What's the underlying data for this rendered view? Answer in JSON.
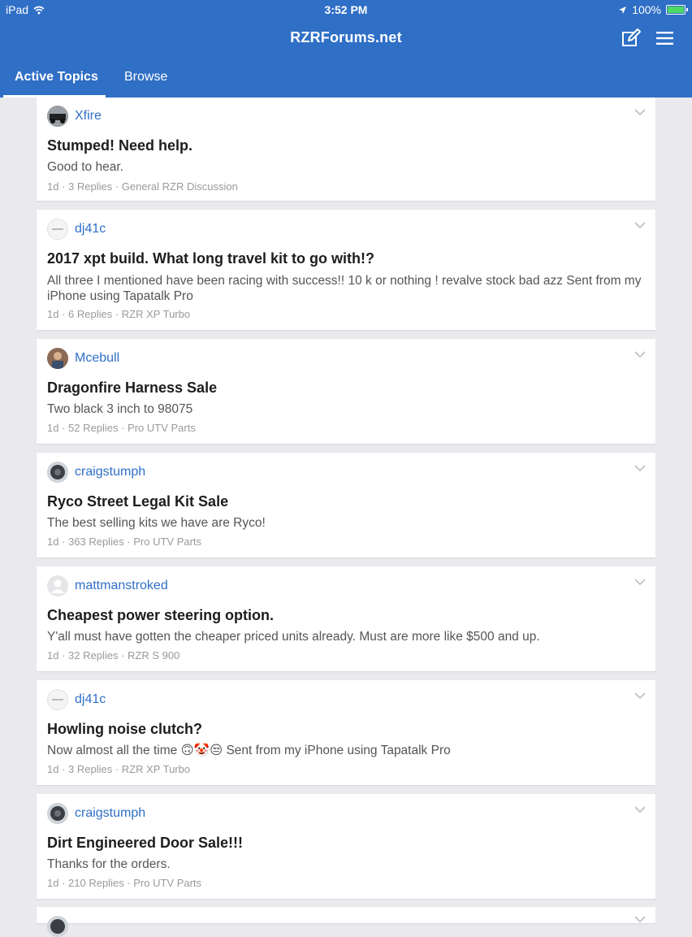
{
  "status_bar": {
    "device": "iPad",
    "time": "3:52 PM",
    "battery": "100%"
  },
  "header": {
    "title": "RZRForums.net"
  },
  "tabs": [
    {
      "label": "Active Topics"
    },
    {
      "label": "Browse"
    }
  ],
  "topics": [
    {
      "author": "Xfire",
      "title": "Stumped! Need help.",
      "snippet": "Good to hear.",
      "age": "1d",
      "replies": "3 Replies",
      "forum": "General RZR Discussion"
    },
    {
      "author": "dj41c",
      "title": "2017 xpt build. What long travel kit to go with!?",
      "snippet": "All three I mentioned have been racing with success!! 10 k or nothing ! revalve stock bad azz Sent from my iPhone using Tapatalk Pro",
      "age": "1d",
      "replies": "6 Replies",
      "forum": "RZR XP Turbo"
    },
    {
      "author": "Mcebull",
      "title": "Dragonfire Harness Sale",
      "snippet": "Two black 3 inch to 98075",
      "age": "1d",
      "replies": "52 Replies",
      "forum": "Pro UTV Parts"
    },
    {
      "author": "craigstumph",
      "title": "Ryco Street Legal Kit Sale",
      "snippet": "The best selling kits we have are Ryco!",
      "age": "1d",
      "replies": "363 Replies",
      "forum": "Pro UTV Parts"
    },
    {
      "author": "mattmanstroked",
      "title": "Cheapest power steering option.",
      "snippet": "Y'all must have gotten the cheaper priced units already. Must are more like $500 and up.",
      "age": "1d",
      "replies": "32 Replies",
      "forum": "RZR S 900"
    },
    {
      "author": "dj41c",
      "title": "Howling noise clutch?",
      "snippet": "Now almost all the time 🙃🤡😒 Sent from my iPhone using Tapatalk Pro",
      "age": "1d",
      "replies": "3 Replies",
      "forum": "RZR XP Turbo"
    },
    {
      "author": "craigstumph",
      "title": "Dirt Engineered Door Sale!!!",
      "snippet": "Thanks for the orders.",
      "age": "1d",
      "replies": "210 Replies",
      "forum": "Pro UTV Parts"
    }
  ],
  "colors": {
    "accent": "#2f6fc6",
    "background": "#e9e9ee"
  },
  "icons": {
    "compose": "compose-icon",
    "menu": "hamburger-menu-icon",
    "expand": "chevron-down-icon"
  }
}
